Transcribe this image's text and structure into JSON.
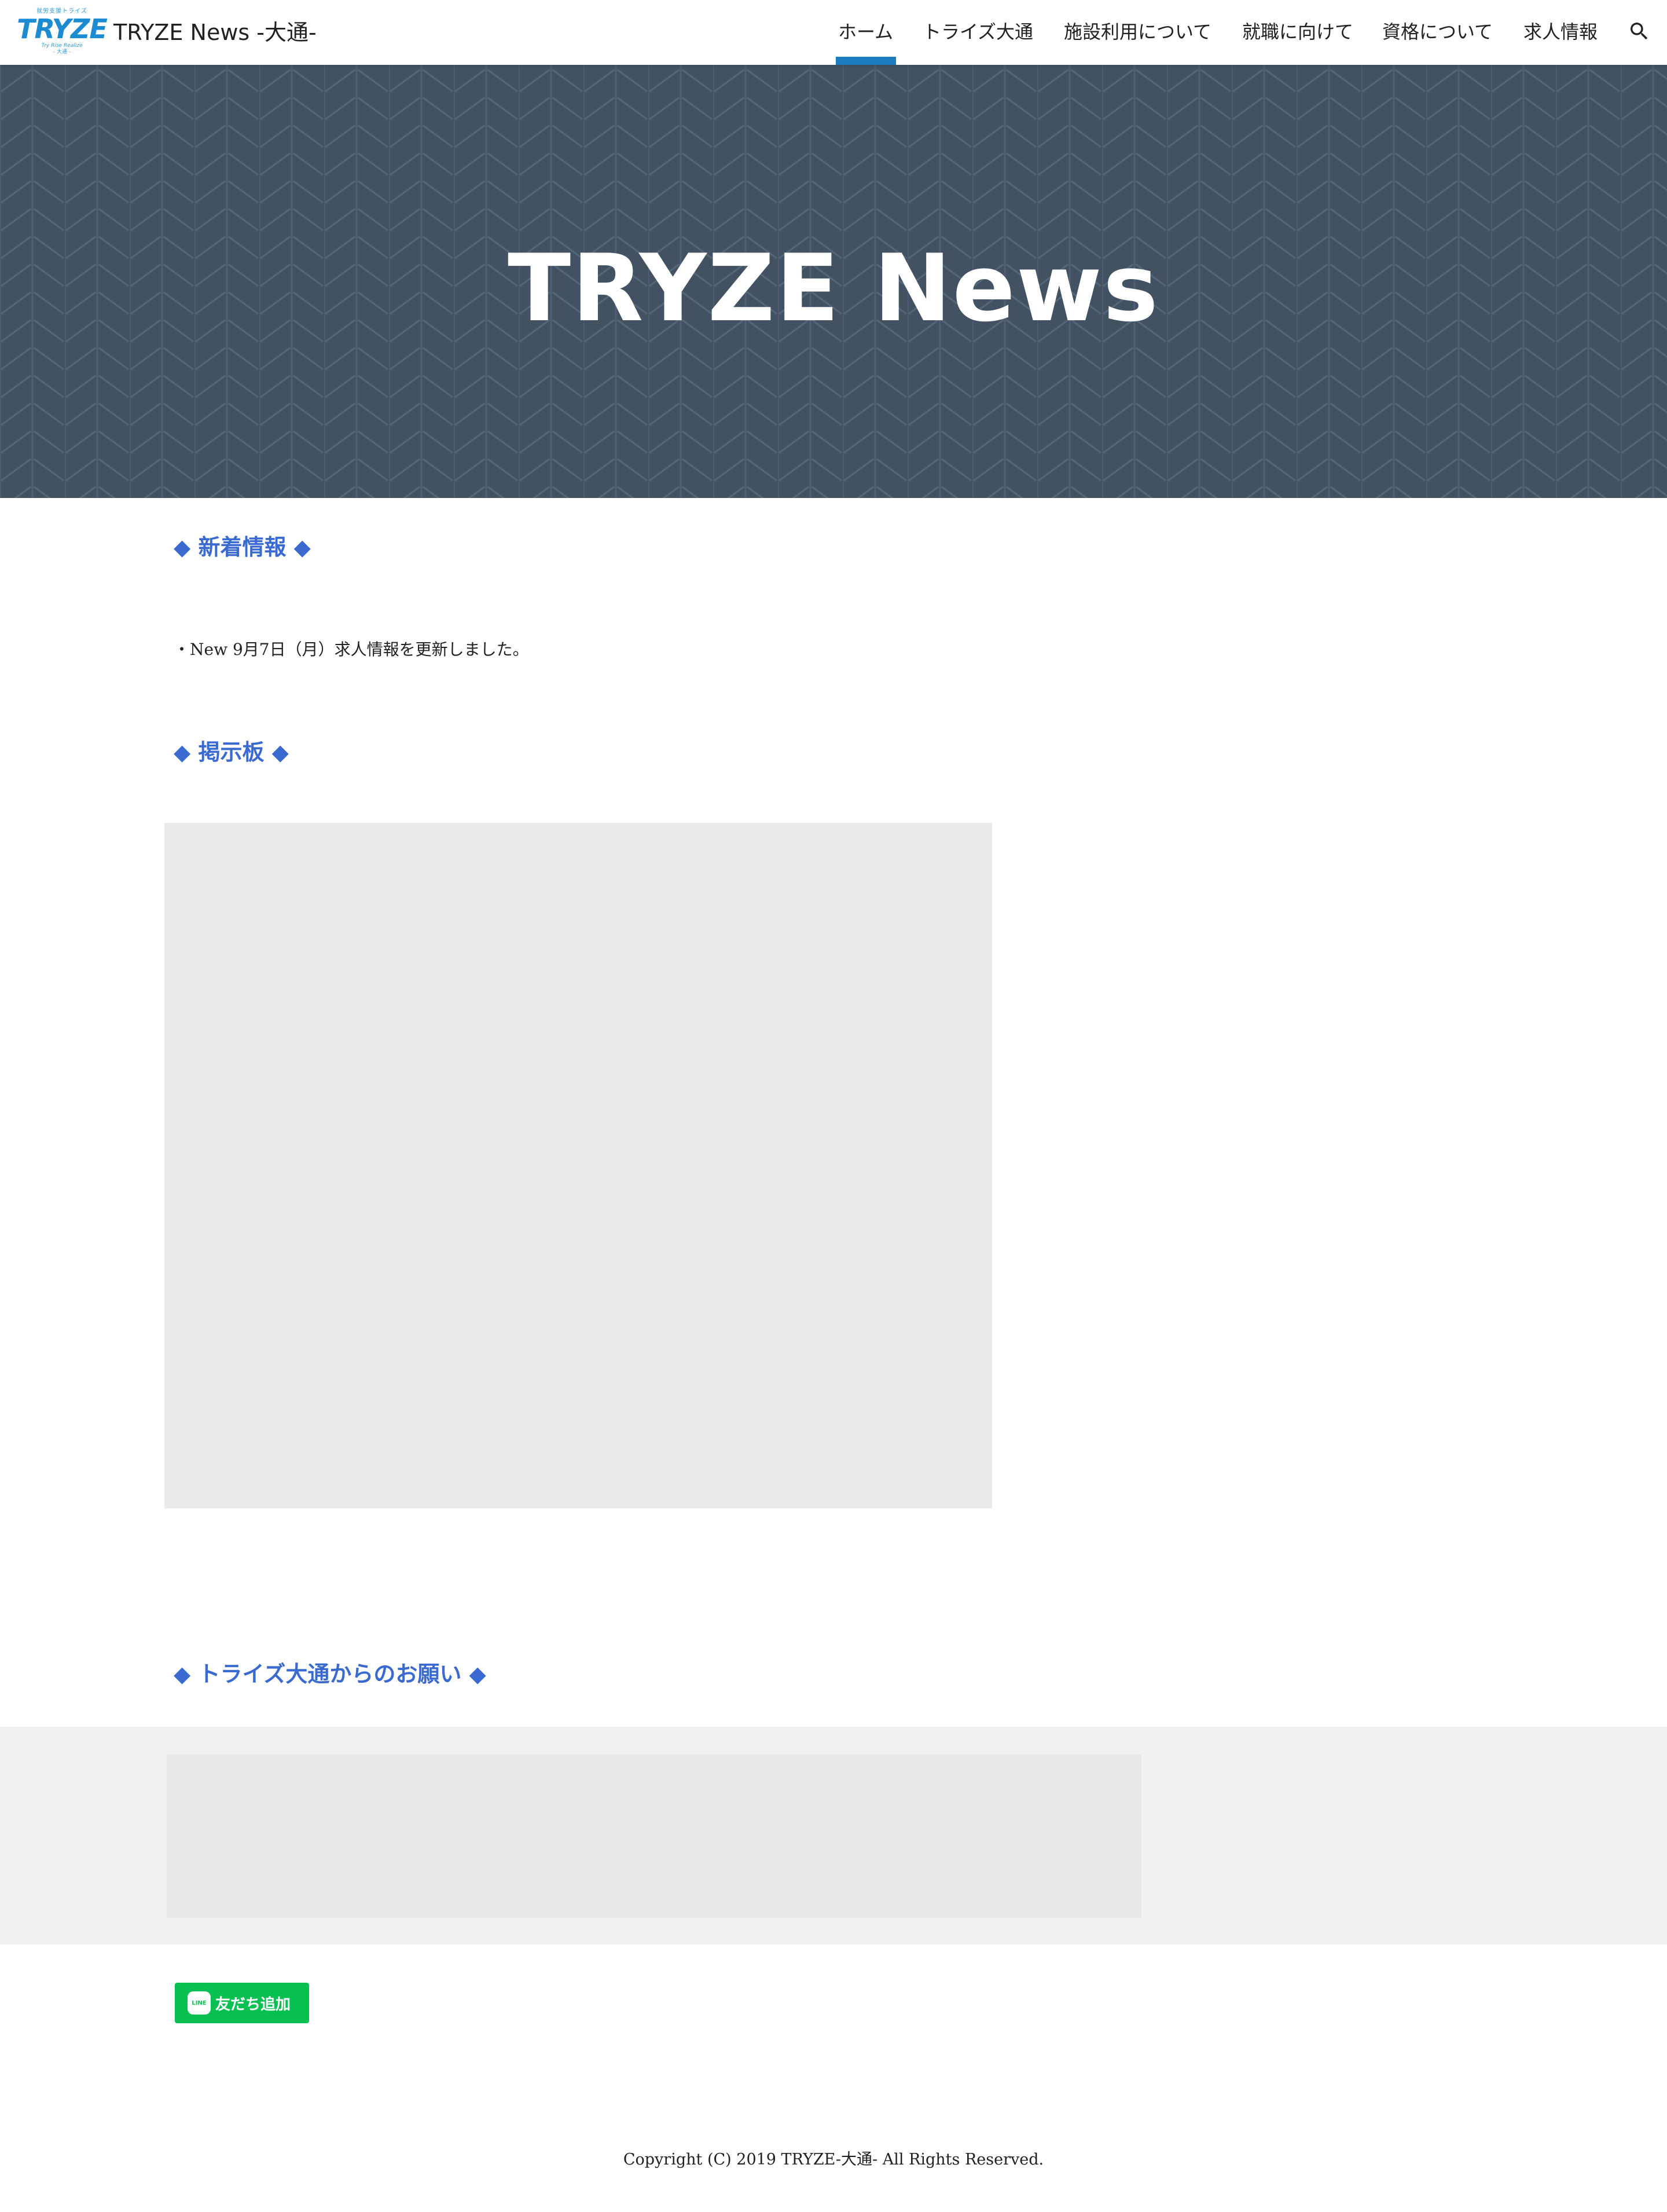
{
  "header": {
    "logo": {
      "top_text": "就労支援トライズ",
      "main_text": "TRYZE",
      "sub_text": "Try Rise Realize",
      "foot_text": "- 大通 -"
    },
    "site_title": "TRYZE News -大通-",
    "nav": [
      {
        "label": "ホーム",
        "active": true
      },
      {
        "label": "トライズ大通",
        "active": false
      },
      {
        "label": "施設利用について",
        "active": false
      },
      {
        "label": "就職に向けて",
        "active": false
      },
      {
        "label": "資格について",
        "active": false
      },
      {
        "label": "求人情報",
        "active": false
      }
    ],
    "search_icon": "search-icon"
  },
  "hero": {
    "title": "TRYZE News",
    "background_color": "#435263"
  },
  "sections": {
    "news_heading": "◆ 新着情報 ◆",
    "news_items": [
      "・New  9月7日（月）求人情報を更新しました。"
    ],
    "board_heading": "◆ 掲示板 ◆",
    "request_heading": "◆ トライズ大通からのお願い ◆"
  },
  "line_button": {
    "badge": "LINE",
    "label": "友だち追加"
  },
  "footer": {
    "copyright": "Copyright (C) 2019 TRYZE-大通- All Rights Reserved."
  },
  "colors": {
    "accent": "#1b7cbf",
    "heading": "#3a6ad0",
    "line_green": "#06c152"
  }
}
